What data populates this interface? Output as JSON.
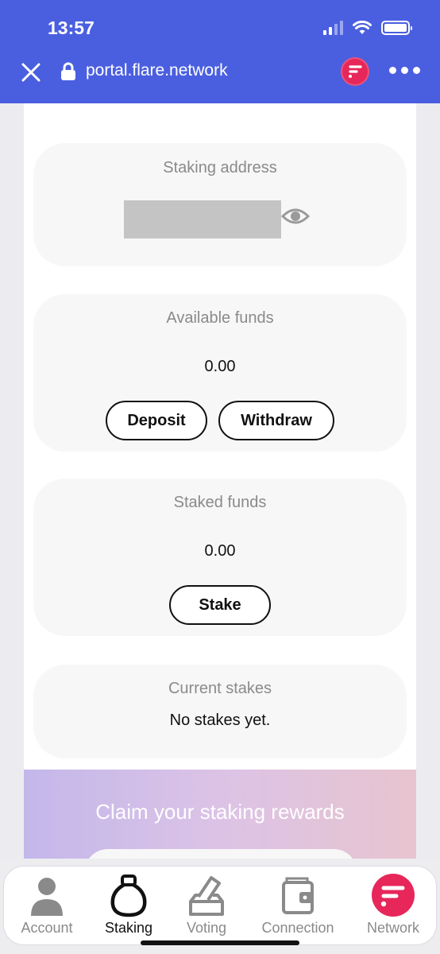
{
  "status_bar": {
    "time": "13:57"
  },
  "browser": {
    "url": "portal.flare.network"
  },
  "cards": {
    "staking_address": {
      "title": "Staking address"
    },
    "available_funds": {
      "title": "Available funds",
      "value": "0.00",
      "deposit_label": "Deposit",
      "withdraw_label": "Withdraw"
    },
    "staked_funds": {
      "title": "Staked funds",
      "value": "0.00",
      "stake_label": "Stake"
    },
    "current_stakes": {
      "title": "Current stakes",
      "empty_text": "No stakes yet."
    }
  },
  "rewards": {
    "title": "Claim your staking rewards"
  },
  "nav": {
    "items": [
      {
        "label": "Account",
        "icon": "account-icon",
        "active": false
      },
      {
        "label": "Staking",
        "icon": "staking-icon",
        "active": true
      },
      {
        "label": "Voting",
        "icon": "voting-icon",
        "active": false
      },
      {
        "label": "Connection",
        "icon": "connection-icon",
        "active": false
      },
      {
        "label": "Network",
        "icon": "flare-network-icon",
        "active": false
      }
    ]
  },
  "colors": {
    "browser_bar": "#4a5fe0",
    "flare_brand": "#e7275a",
    "card_bg": "#f7f7f7"
  }
}
